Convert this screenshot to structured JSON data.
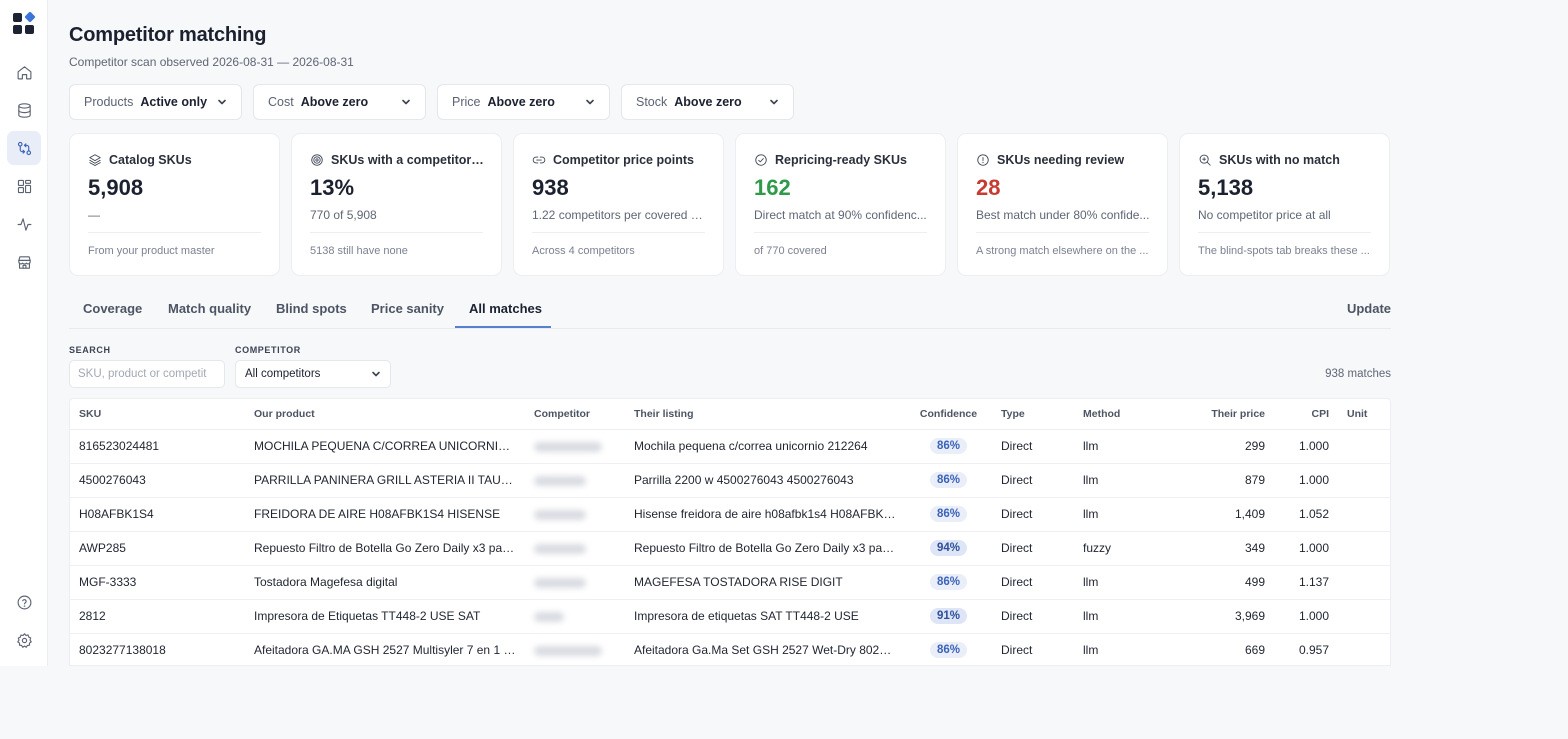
{
  "page": {
    "title": "Competitor matching",
    "subtitle": "Competitor scan observed 2026-08-31 — 2026-08-31"
  },
  "sidebar": {
    "icons": [
      "logo-icon",
      "home-icon",
      "database-icon",
      "compare-icon",
      "layout-grid-icon",
      "activity-icon",
      "store-icon",
      "help-icon",
      "settings-icon"
    ],
    "active": "compare-icon"
  },
  "filters": [
    {
      "label": "Products",
      "value": "Active only"
    },
    {
      "label": "Cost",
      "value": "Above zero"
    },
    {
      "label": "Price",
      "value": "Above zero"
    },
    {
      "label": "Stock",
      "value": "Above zero"
    }
  ],
  "cards": [
    {
      "icon": "layers-icon",
      "title": "Catalog SKUs",
      "value": "5,908",
      "sub": "—",
      "foot": "From your product master"
    },
    {
      "icon": "target-icon",
      "title": "SKUs with a competitor pr...",
      "value": "13%",
      "sub": "770 of 5,908",
      "foot": "5138 still have none"
    },
    {
      "icon": "link-icon",
      "title": "Competitor price points",
      "value": "938",
      "sub": "1.22 competitors per covered S...",
      "foot": "Across 4 competitors"
    },
    {
      "icon": "check-circle-icon",
      "title": "Repricing-ready SKUs",
      "value": "162",
      "sub": "Direct match at 90% confidenc...",
      "foot": "of 770 covered"
    },
    {
      "icon": "alert-circle-icon",
      "title": "SKUs needing review",
      "value": "28",
      "sub": "Best match under 80% confide...",
      "foot": "A strong match elsewhere on the ..."
    },
    {
      "icon": "search-zoom-icon",
      "title": "SKUs with no match",
      "value": "5,138",
      "sub": "No competitor price at all",
      "foot": "The blind-spots tab breaks these ..."
    }
  ],
  "colors": {
    "accent": "#3a63b8",
    "positive": "#2f9a4a",
    "negative": "#c63b32"
  },
  "tabs": [
    "Coverage",
    "Match quality",
    "Blind spots",
    "Price sanity",
    "All matches"
  ],
  "active_tab": "All matches",
  "update_label": "Update",
  "search": {
    "label": "SEARCH",
    "placeholder": "SKU, product or competit"
  },
  "competitor": {
    "label": "COMPETITOR",
    "value": "All competitors"
  },
  "match_count": "938 matches",
  "table": {
    "columns": [
      "SKU",
      "Our product",
      "Competitor",
      "Their listing",
      "Confidence",
      "Type",
      "Method",
      "Their price",
      "CPI",
      "Unit"
    ],
    "rows": [
      {
        "sku": "816523024481",
        "product": "MOCHILA PEQUENA C/CORREA UNICORNIO 2122...",
        "listing": "Mochila pequena c/correa unicornio 212264",
        "confidence": "86%",
        "type": "Direct",
        "method": "llm",
        "price": "299",
        "cpi": "1.000",
        "unit": ""
      },
      {
        "sku": "4500276043",
        "product": "PARRILLA PANINERA GRILL ASTERIA II TAURUS 2...",
        "listing": "Parrilla 2200 w 4500276043 4500276043",
        "confidence": "86%",
        "type": "Direct",
        "method": "llm",
        "price": "879",
        "cpi": "1.000",
        "unit": ""
      },
      {
        "sku": "H08AFBK1S4",
        "product": "FREIDORA DE AIRE H08AFBK1S4 HISENSE",
        "listing": "Hisense freidora de aire h08afbk1s4 H08AFBK1S4",
        "confidence": "86%",
        "type": "Direct",
        "method": "llm",
        "price": "1,409",
        "cpi": "1.052",
        "unit": ""
      },
      {
        "sku": "AWP285",
        "product": "Repuesto Filtro de Botella Go Zero Daily x3 para T...",
        "listing": "Repuesto Filtro de Botella Go Zero Daily x3 para T...",
        "confidence": "94%",
        "type": "Direct",
        "method": "fuzzy",
        "price": "349",
        "cpi": "1.000",
        "unit": ""
      },
      {
        "sku": "MGF-3333",
        "product": "Tostadora Magefesa digital",
        "listing": "MAGEFESA TOSTADORA RISE DIGIT",
        "confidence": "86%",
        "type": "Direct",
        "method": "llm",
        "price": "499",
        "cpi": "1.137",
        "unit": ""
      },
      {
        "sku": "2812",
        "product": "Impresora de Etiquetas TT448-2 USE SAT",
        "listing": "Impresora de etiquetas SAT TT448-2 USE",
        "confidence": "91%",
        "type": "Direct",
        "method": "llm",
        "price": "3,969",
        "cpi": "1.000",
        "unit": ""
      },
      {
        "sku": "8023277138018",
        "product": "Afeitadora GA.MA GSH 2527 Multisyler 7 en 1 Wet...",
        "listing": "Afeitadora Ga.Ma Set GSH 2527 Wet-Dry 802327...",
        "confidence": "86%",
        "type": "Direct",
        "method": "llm",
        "price": "669",
        "cpi": "0.957",
        "unit": ""
      }
    ]
  }
}
